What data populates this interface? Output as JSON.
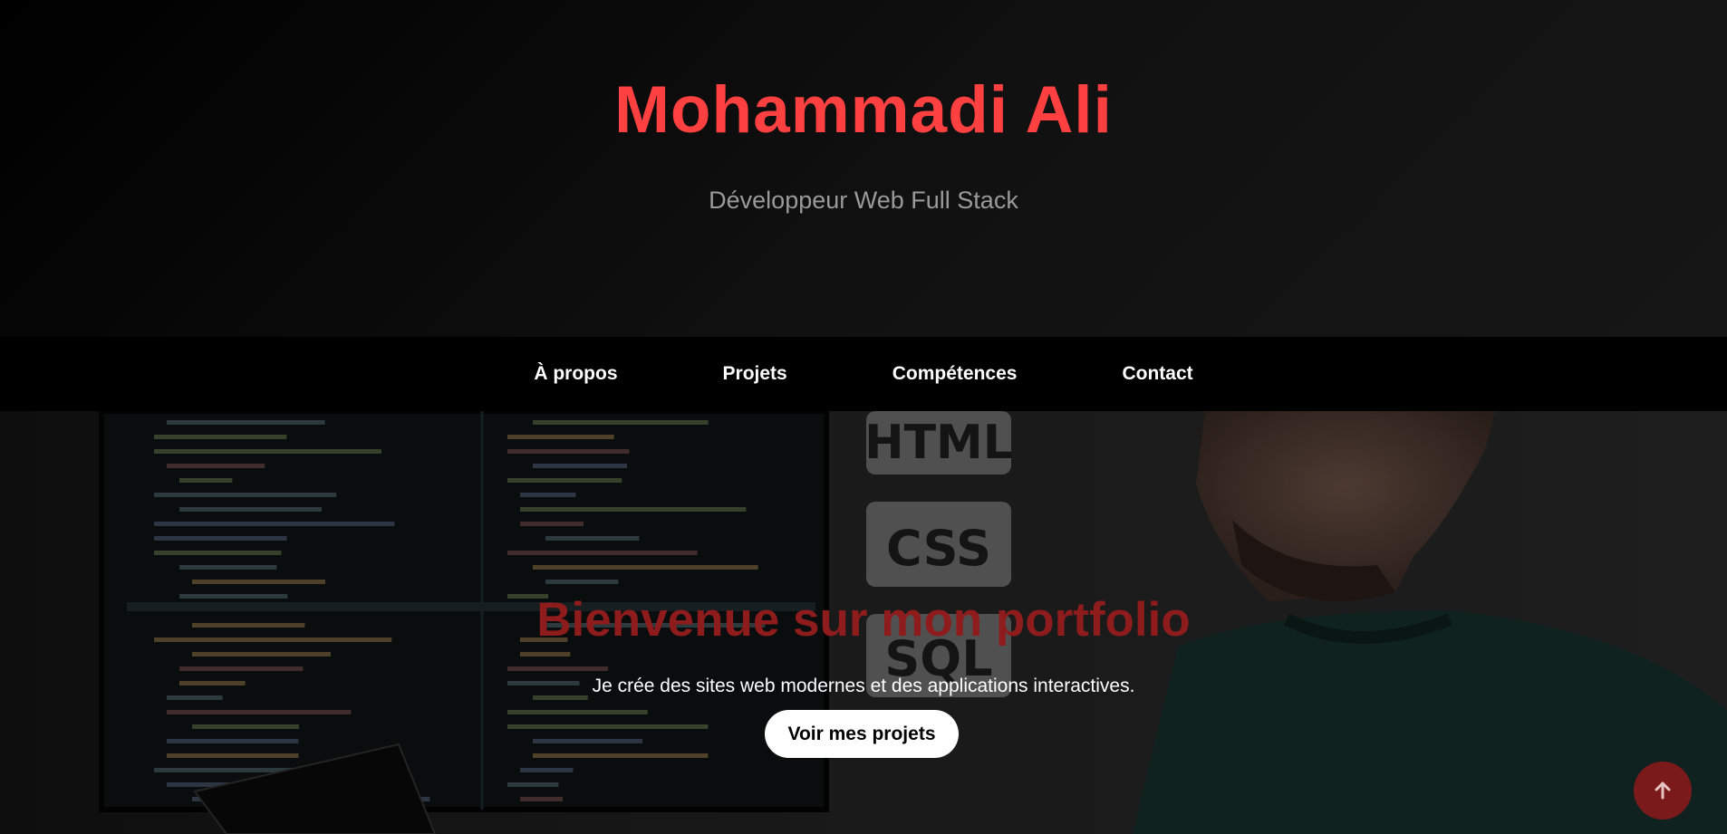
{
  "header": {
    "title": "Mohammadi Ali",
    "subtitle": "Développeur Web Full Stack"
  },
  "nav": {
    "items": [
      {
        "label": "À propos"
      },
      {
        "label": "Projets"
      },
      {
        "label": "Compétences"
      },
      {
        "label": "Contact"
      }
    ]
  },
  "hero": {
    "title": "Bienvenue sur mon portfolio",
    "text": "Je crée des sites web modernes et des applications interactives.",
    "cta_label": "Voir mes projets",
    "background": {
      "tiles": [
        "HTML",
        "CSS",
        "SQL"
      ]
    }
  },
  "scroll_top": {
    "icon": "arrow-up-icon"
  },
  "colors": {
    "accent": "#ff4040",
    "hero_title": "#8e1c1c",
    "nav_bg": "#000000",
    "scroll_btn": "#7a1a1a"
  }
}
